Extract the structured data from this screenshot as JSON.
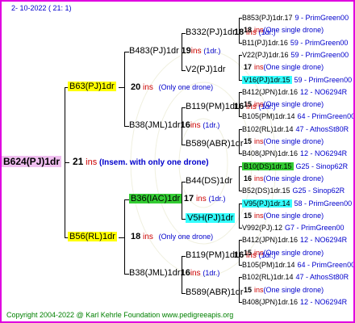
{
  "header": {
    "date": "2- 10-2022 ( 21: 1)"
  },
  "footer": {
    "copyright": "Copyright 2004-2022 @ Karl Kehrle Foundation www.pedigreeapis.org"
  },
  "root": {
    "name": "B624(PJ)1dr",
    "count": "21",
    "ins": "ins",
    "note": "(Insem. with only one drone)"
  },
  "sire": {
    "name": "B63(PJ)1dr",
    "count": "20",
    "ins": "ins",
    "note": "(Only one drone)"
  },
  "dam": {
    "name": "B56(RL)1dr",
    "count": "18",
    "ins": "ins",
    "note": "(Only one drone)"
  },
  "sire_sire": {
    "name": "B483(PJ)1dr",
    "count": "19",
    "ins": "ins",
    "note": "(1dr.)"
  },
  "sire_dam": {
    "name": "B38(JML)1dr",
    "count": "16",
    "ins": "ins",
    "note": "(1dr.)"
  },
  "dam_sire": {
    "name": "B36(IAC)1dr",
    "count": "17",
    "ins": "ins",
    "note": "(1dr.)"
  },
  "dam_dam": {
    "name": "B38(JML)1dr",
    "count": "16",
    "ins": "ins",
    "note": "(1dr.)"
  },
  "gen3": [
    {
      "name": "B332(PJ)1dr",
      "count": "18",
      "ins": "ins",
      "note": "(1dr.)"
    },
    {
      "name": "V2(PJ)1dr",
      "count": "",
      "ins": "",
      "note": ""
    },
    {
      "name": "B119(PM)1dr",
      "count": "16",
      "ins": "ins",
      "note": "(1dr.)"
    },
    {
      "name": "B589(ABR)1dr",
      "count": "",
      "ins": "",
      "note": ""
    },
    {
      "name": "B44(DS)1dr",
      "count": "",
      "ins": "",
      "note": ""
    },
    {
      "name": "V5H(PJ)1dr",
      "count": "",
      "ins": "",
      "note": ""
    },
    {
      "name": "B119(PM)1dr",
      "count": "16",
      "ins": "ins",
      "note": "(1dr.)"
    },
    {
      "name": "B589(ABR)1dr",
      "count": "",
      "ins": "",
      "note": ""
    }
  ],
  "gen4": [
    {
      "id": "B853(PJ)1dr.17",
      "drone": "9 - PrimGreen00"
    },
    {
      "sub_count": "18",
      "sub_ins": "ins",
      "sub_note": "(One single drone)"
    },
    {
      "id": "B11(PJ)1dr.16",
      "drone": "59 - PrimGreen00"
    },
    {
      "id": "V22(PJ)1dr.16",
      "drone": "59 - PrimGreen00"
    },
    {
      "sub_count": "17",
      "sub_ins": "ins",
      "sub_note": "(One single drone)"
    },
    {
      "id": "V16(PJ)1dr.15",
      "drone": "59 - PrimGreen00"
    },
    {
      "id": "B412(JPN)1dr.16",
      "drone": "12 - NO6294R"
    },
    {
      "sub_count": "15",
      "sub_ins": "ins",
      "sub_note": "(One single drone)"
    },
    {
      "id": "B105(PM)1dr.14",
      "drone": "64 - PrimGreen00"
    },
    {
      "id": "B102(RL)1dr.14",
      "drone": "47 - AthosSt80R"
    },
    {
      "sub_count": "15",
      "sub_ins": "ins",
      "sub_note": "(One single drone)"
    },
    {
      "id": "B408(JPN)1dr.16",
      "drone": "12 - NO6294R"
    },
    {
      "id": "B10(DS)1dr.15",
      "drone": "G25 - Sinop62R"
    },
    {
      "sub_count": "16",
      "sub_ins": "ins",
      "sub_note": "(One single drone)"
    },
    {
      "id": "B52(DS)1dr.15",
      "drone": "G25 - Sinop62R"
    },
    {
      "id": "V95(PJ)1dr.14",
      "drone": "58 - PrimGreen00"
    },
    {
      "sub_count": "15",
      "sub_ins": "ins",
      "sub_note": "(One single drone)"
    },
    {
      "id": "V992(PJ).12",
      "drone": "G7 - PrimGreen00"
    },
    {
      "id": "B412(JPN)1dr.16",
      "drone": "12 - NO6294R"
    },
    {
      "sub_count": "15",
      "sub_ins": "ins",
      "sub_note": "(One single drone)"
    },
    {
      "id": "B105(PM)1dr.14",
      "drone": "64 - PrimGreen00"
    },
    {
      "id": "B102(RL)1dr.14",
      "drone": "47 - AthosSt80R"
    },
    {
      "sub_count": "15",
      "sub_ins": "ins",
      "sub_note": "(One single drone)"
    },
    {
      "id": "B408(JPN)1dr.16",
      "drone": "12 - NO6294R"
    }
  ],
  "colors": {
    "frame": "#e000e0",
    "root_bg": "#f0c0f0",
    "parent_bg": "#ffff00",
    "green_bg": "#33cc33",
    "cyan_bg": "#33ffff",
    "ins": "#cc0000",
    "note": "#0000cc",
    "copyright": "#008000"
  }
}
